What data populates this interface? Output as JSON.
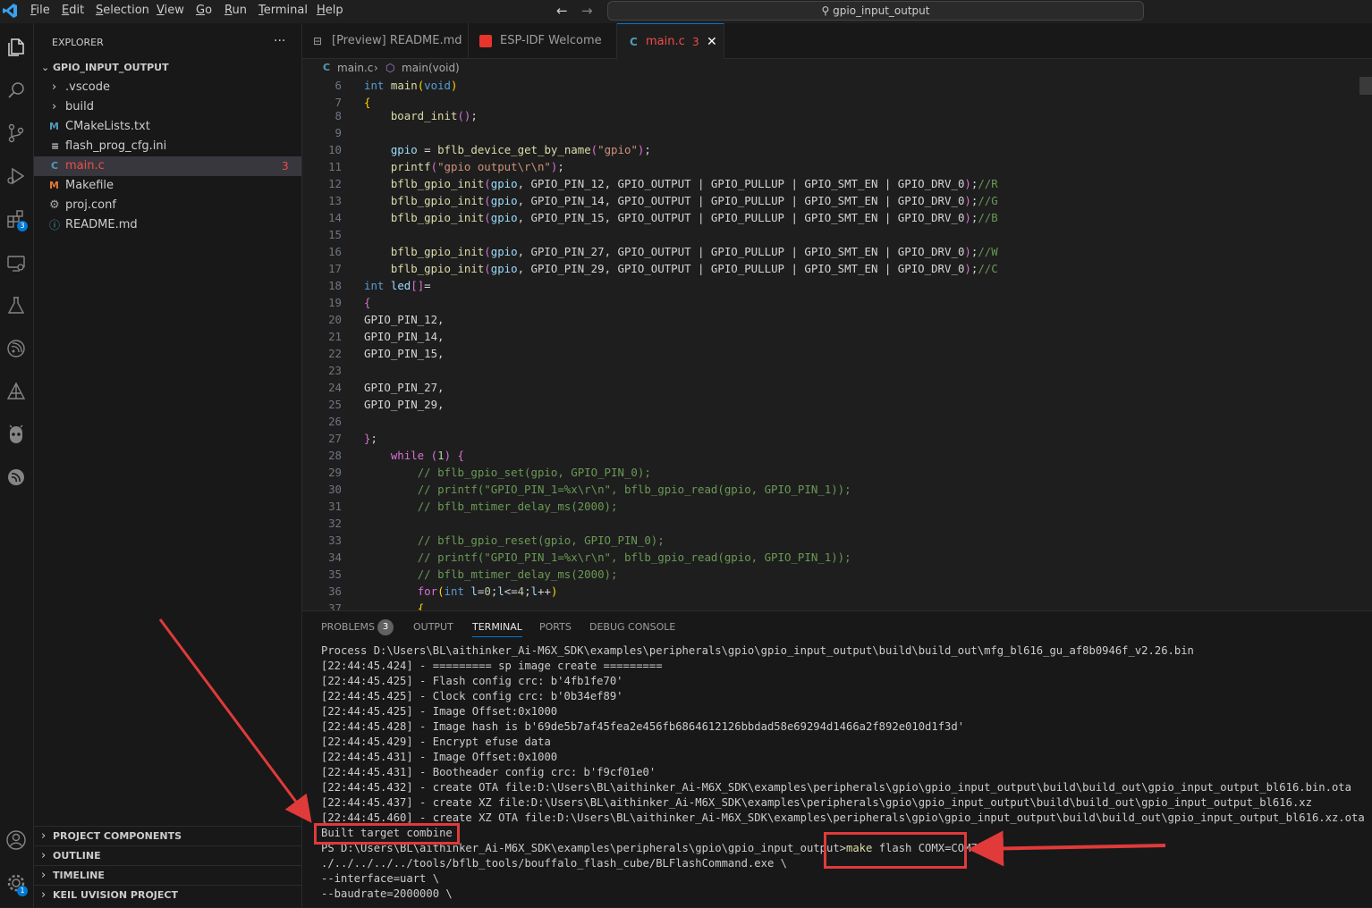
{
  "menu": [
    "File",
    "Edit",
    "Selection",
    "View",
    "Go",
    "Run",
    "Terminal",
    "Help"
  ],
  "search": {
    "label": "gpio_input_output"
  },
  "activity_badges": {
    "extensions": "3",
    "manage": "1"
  },
  "explorer": {
    "title": "EXPLORER",
    "more": "···",
    "root": "GPIO_INPUT_OUTPUT",
    "items": [
      {
        "label": ".vscode",
        "icon": "chevron-right"
      },
      {
        "label": "build",
        "icon": "chevron-right"
      },
      {
        "label": "CMakeLists.txt",
        "icon": "M"
      },
      {
        "label": "flash_prog_cfg.ini",
        "icon": "≡"
      },
      {
        "label": "main.c",
        "icon": "C",
        "badge": "3"
      },
      {
        "label": "Makefile",
        "icon": "M"
      },
      {
        "label": "proj.conf",
        "icon": "⚙"
      },
      {
        "label": "README.md",
        "icon": "ⓘ"
      }
    ],
    "sections": [
      "PROJECT COMPONENTS",
      "OUTLINE",
      "TIMELINE",
      "KEIL UVISION PROJECT"
    ]
  },
  "tabs": [
    {
      "label": "[Preview] README.md"
    },
    {
      "label": "ESP-IDF Welcome"
    },
    {
      "label": "main.c",
      "badge": "3",
      "active": true
    }
  ],
  "breadcrumb": {
    "file": "main.c",
    "symbol": "main(void)"
  },
  "code": {
    "line_numbers": [
      "6",
      "7",
      "8",
      "9",
      "10",
      "11",
      "12",
      "13",
      "14",
      "15",
      "16",
      "17",
      "18",
      "19",
      "20",
      "21",
      "22",
      "23",
      "24",
      "25",
      "26",
      "27",
      "28",
      "29",
      "30",
      "31",
      "32",
      "33",
      "34",
      "35",
      "36",
      "37"
    ]
  },
  "panel": {
    "tabs": [
      "PROBLEMS",
      "OUTPUT",
      "TERMINAL",
      "PORTS",
      "DEBUG CONSOLE"
    ],
    "problems_count": "3",
    "terminal_lines": [
      "Process D:\\Users\\BL\\aithinker_Ai-M6X_SDK\\examples\\peripherals\\gpio\\gpio_input_output\\build\\build_out\\mfg_bl616_gu_af8b0946f_v2.26.bin",
      "[22:44:45.424] - ========= sp image create =========",
      "[22:44:45.425] - Flash config crc: b'4fb1fe70'",
      "[22:44:45.425] - Clock config crc: b'0b34ef89'",
      "[22:44:45.425] - Image Offset:0x1000",
      "[22:44:45.428] - Image hash is b'69de5b7af45fea2e456fb6864612126bbdad58e69294d1466a2f892e010d1f3d'",
      "[22:44:45.429] - Encrypt efuse data",
      "[22:44:45.431] - Image Offset:0x1000",
      "[22:44:45.431] - Bootheader config crc: b'f9cf01e0'",
      "[22:44:45.432] - create OTA file:D:\\Users\\BL\\aithinker_Ai-M6X_SDK\\examples\\peripherals\\gpio\\gpio_input_output\\build\\build_out\\gpio_input_output_bl616.bin.ota",
      "[22:44:45.437] - create XZ file:D:\\Users\\BL\\aithinker_Ai-M6X_SDK\\examples\\peripherals\\gpio\\gpio_input_output\\build\\build_out\\gpio_input_output_bl616.xz",
      "[22:44:45.460] - create XZ OTA file:D:\\Users\\BL\\aithinker_Ai-M6X_SDK\\examples\\peripherals\\gpio\\gpio_input_output\\build\\build_out\\gpio_input_output_bl616.xz.ota",
      "Built target combine"
    ],
    "prompt": "PS D:\\Users\\BL\\aithinker_Ai-M6X_SDK\\examples\\peripherals\\gpio\\gpio_input_output>",
    "command_keyword": "make",
    "command_args": " flash COMX=COM7",
    "continuation": [
      "./../../../../tools/bflb_tools/bouffalo_flash_cube/BLFlashCommand.exe \\",
      "--interface=uart \\",
      "--baudrate=2000000 \\"
    ]
  },
  "colors": {
    "annotation": "#e03a3a",
    "accent": "#0078d4"
  }
}
